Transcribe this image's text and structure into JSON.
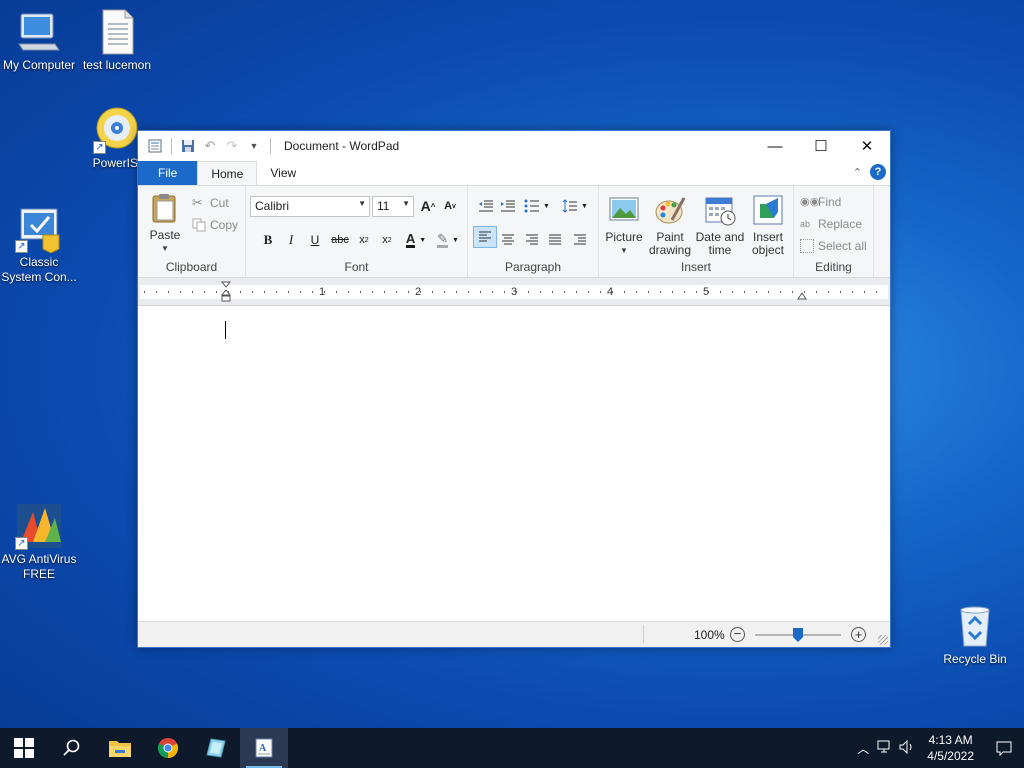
{
  "desktop": {
    "icons": [
      {
        "label": "My Computer",
        "icon": "computer-icon"
      },
      {
        "label": "test lucemon",
        "icon": "text-file-icon"
      },
      {
        "label": "PowerISO",
        "icon": "poweriso-icon"
      },
      {
        "label": "Classic System Con...",
        "icon": "control-panel-icon"
      },
      {
        "label": "AVG AntiVirus FREE",
        "icon": "avg-icon"
      },
      {
        "label": "Recycle Bin",
        "icon": "recycle-bin-icon"
      }
    ]
  },
  "window": {
    "title": "Document - WordPad",
    "tabs": [
      {
        "label": "File"
      },
      {
        "label": "Home"
      },
      {
        "label": "View"
      }
    ],
    "clipboard": {
      "paste": "Paste",
      "cut": "Cut",
      "copy": "Copy",
      "label": "Clipboard"
    },
    "font": {
      "family": "Calibri",
      "size": "11",
      "label": "Font"
    },
    "paragraph": {
      "label": "Paragraph"
    },
    "insert": {
      "picture": "Picture",
      "paint_drawing": "Paint drawing",
      "date_time": "Date and time",
      "insert_object": "Insert object",
      "label": "Insert"
    },
    "editing": {
      "find": "Find",
      "replace": "Replace",
      "select_all": "Select all",
      "label": "Editing"
    },
    "ruler": {
      "numbers": [
        "1",
        "2",
        "3",
        "4",
        "5"
      ]
    },
    "status": {
      "zoom": "100%",
      "zoom_level": 0.5
    }
  },
  "taskbar": {
    "time": "4:13 AM",
    "date": "4/5/2022"
  },
  "colors": {
    "accent": "#1b6ac9",
    "taskbar": "#0e1a2b"
  }
}
